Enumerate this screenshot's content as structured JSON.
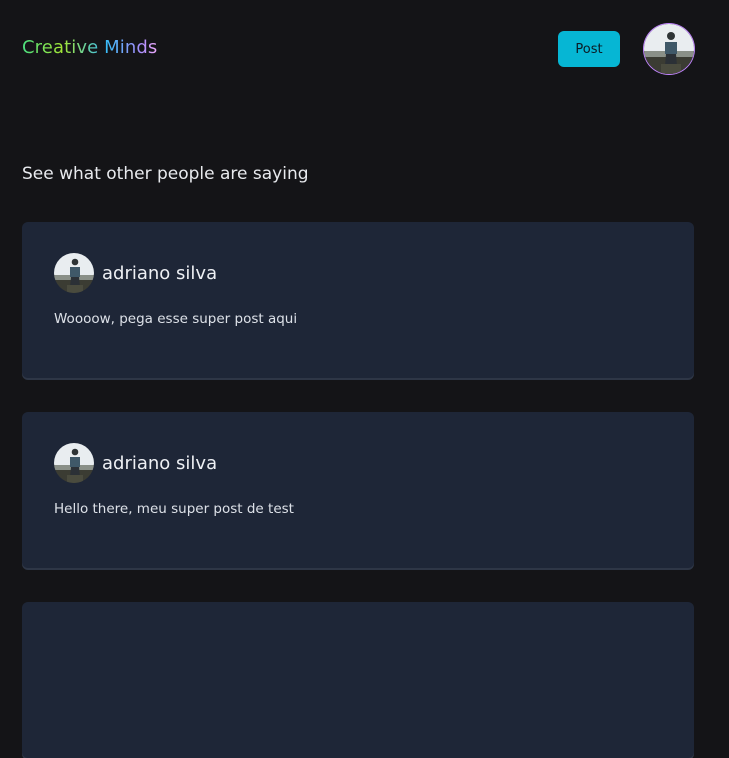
{
  "header": {
    "logo_text": "Creative Minds",
    "post_button_label": "Post",
    "avatar_icon": "user-avatar-photo"
  },
  "main": {
    "section_title": "See what other people are saying",
    "posts": [
      {
        "author": "adriano silva",
        "text": "Woooow, pega esse super post aqui"
      },
      {
        "author": "adriano silva",
        "text": "Hello there, meu super post de test"
      },
      {
        "author": "",
        "text": ""
      }
    ]
  },
  "colors": {
    "background": "#141417",
    "card": "#1e2637",
    "accent": "#06b6d4"
  }
}
